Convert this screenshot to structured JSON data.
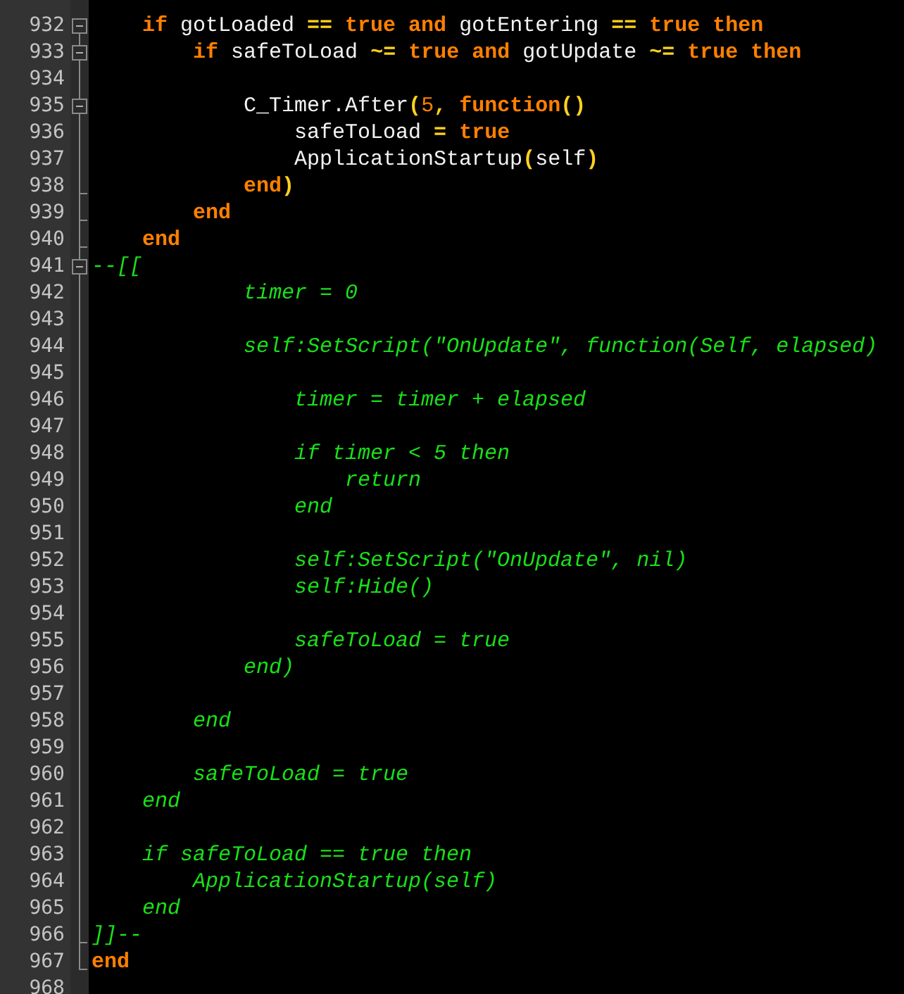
{
  "editor": {
    "lines": [
      {
        "number": "932",
        "expanded": true,
        "tokens": [
          {
            "kind": "keyword",
            "text": "    if "
          },
          {
            "kind": "identifier",
            "text": "gotLoaded "
          },
          {
            "kind": "operator",
            "text": "== "
          },
          {
            "kind": "keyword",
            "text": "true and "
          },
          {
            "kind": "identifier",
            "text": "gotEntering "
          },
          {
            "kind": "operator",
            "text": "== "
          },
          {
            "kind": "keyword",
            "text": "true then"
          }
        ]
      },
      {
        "number": "933",
        "expanded": true,
        "tokens": [
          {
            "kind": "keyword",
            "text": "        if "
          },
          {
            "kind": "identifier",
            "text": "safeToLoad "
          },
          {
            "kind": "operator",
            "text": "~= "
          },
          {
            "kind": "keyword",
            "text": "true and "
          },
          {
            "kind": "identifier",
            "text": "gotUpdate "
          },
          {
            "kind": "operator",
            "text": "~= "
          },
          {
            "kind": "keyword",
            "text": "true then"
          }
        ]
      },
      {
        "number": "934"
      },
      {
        "number": "935",
        "expanded": true,
        "tokens": [
          {
            "kind": "identifier",
            "text": "            C_Timer.After"
          },
          {
            "kind": "operator",
            "text": "("
          },
          {
            "kind": "number",
            "text": "5"
          },
          {
            "kind": "operator",
            "text": ", "
          },
          {
            "kind": "keyword",
            "text": "function"
          },
          {
            "kind": "operator",
            "text": "()"
          }
        ]
      },
      {
        "number": "936",
        "tokens": [
          {
            "kind": "identifier",
            "text": "                safeToLoad "
          },
          {
            "kind": "operator",
            "text": "= "
          },
          {
            "kind": "keyword",
            "text": "true"
          }
        ]
      },
      {
        "number": "937",
        "tokens": [
          {
            "kind": "identifier",
            "text": "                ApplicationStartup"
          },
          {
            "kind": "operator",
            "text": "("
          },
          {
            "kind": "identifier",
            "text": "self"
          },
          {
            "kind": "operator",
            "text": ")"
          }
        ]
      },
      {
        "number": "938",
        "block_end": true,
        "tokens": [
          {
            "kind": "keyword",
            "text": "            end"
          },
          {
            "kind": "operator",
            "text": ")"
          }
        ]
      },
      {
        "number": "939",
        "block_end": true,
        "tokens": [
          {
            "kind": "keyword",
            "text": "        end"
          }
        ]
      },
      {
        "number": "940",
        "block_end": true,
        "tokens": [
          {
            "kind": "keyword",
            "text": "    end"
          }
        ]
      },
      {
        "number": "941",
        "expanded": true,
        "tokens": [
          {
            "kind": "comment",
            "text": "--[["
          }
        ]
      },
      {
        "number": "942",
        "tokens": [
          {
            "kind": "comment",
            "text": "            timer = 0"
          }
        ]
      },
      {
        "number": "943"
      },
      {
        "number": "944",
        "tokens": [
          {
            "kind": "comment",
            "text": "            self:SetScript(\"OnUpdate\", function(Self, elapsed)"
          }
        ]
      },
      {
        "number": "945"
      },
      {
        "number": "946",
        "tokens": [
          {
            "kind": "comment",
            "text": "                timer = timer + elapsed"
          }
        ]
      },
      {
        "number": "947"
      },
      {
        "number": "948",
        "tokens": [
          {
            "kind": "comment",
            "text": "                if timer < 5 then"
          }
        ]
      },
      {
        "number": "949",
        "tokens": [
          {
            "kind": "comment",
            "text": "                    return"
          }
        ]
      },
      {
        "number": "950",
        "tokens": [
          {
            "kind": "comment",
            "text": "                end"
          }
        ]
      },
      {
        "number": "951"
      },
      {
        "number": "952",
        "tokens": [
          {
            "kind": "comment",
            "text": "                self:SetScript(\"OnUpdate\", nil)"
          }
        ]
      },
      {
        "number": "953",
        "tokens": [
          {
            "kind": "comment",
            "text": "                self:Hide()"
          }
        ]
      },
      {
        "number": "954"
      },
      {
        "number": "955",
        "tokens": [
          {
            "kind": "comment",
            "text": "                safeToLoad = true"
          }
        ]
      },
      {
        "number": "956",
        "tokens": [
          {
            "kind": "comment",
            "text": "            end)"
          }
        ]
      },
      {
        "number": "957"
      },
      {
        "number": "958",
        "tokens": [
          {
            "kind": "comment",
            "text": "        end"
          }
        ]
      },
      {
        "number": "959"
      },
      {
        "number": "960",
        "tokens": [
          {
            "kind": "comment",
            "text": "        safeToLoad = true"
          }
        ]
      },
      {
        "number": "961",
        "tokens": [
          {
            "kind": "comment",
            "text": "    end"
          }
        ]
      },
      {
        "number": "962"
      },
      {
        "number": "963",
        "tokens": [
          {
            "kind": "comment",
            "text": "    if safeToLoad == true then"
          }
        ]
      },
      {
        "number": "964",
        "tokens": [
          {
            "kind": "comment",
            "text": "        ApplicationStartup(self)"
          }
        ]
      },
      {
        "number": "965",
        "tokens": [
          {
            "kind": "comment",
            "text": "    end"
          }
        ]
      },
      {
        "number": "966",
        "block_end": true,
        "tokens": [
          {
            "kind": "comment",
            "text": "]]--"
          }
        ]
      },
      {
        "number": "967",
        "block_end": true,
        "tokens": [
          {
            "kind": "keyword",
            "text": "end"
          }
        ]
      },
      {
        "number": "968"
      }
    ]
  }
}
